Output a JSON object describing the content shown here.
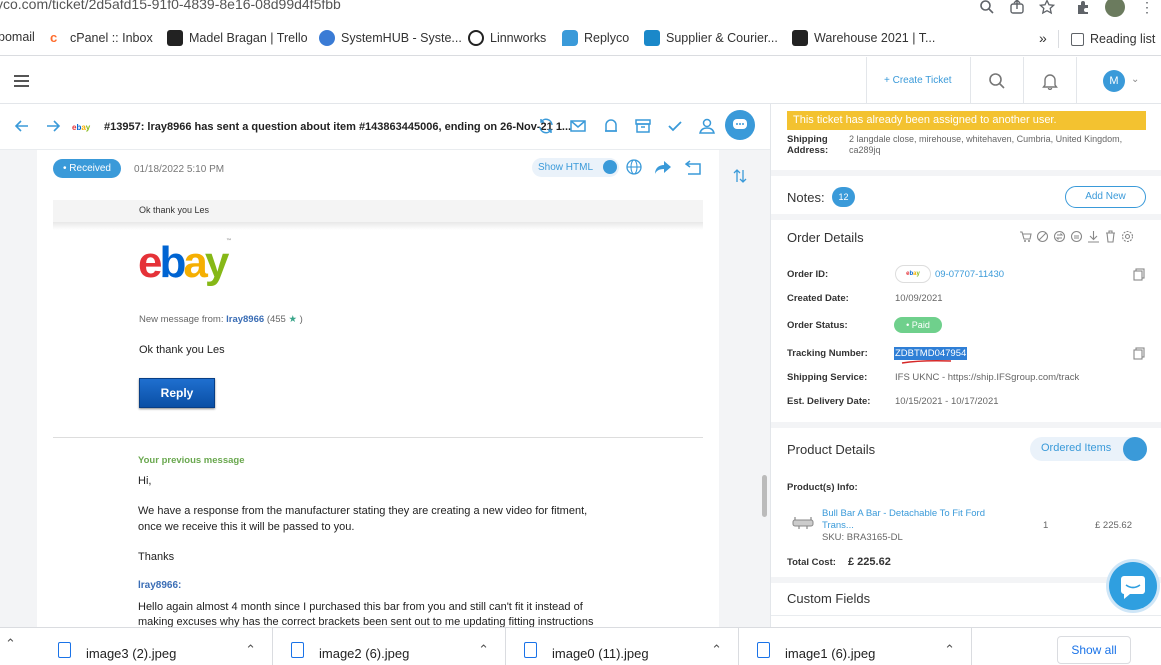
{
  "browser": {
    "url_prefix": "yco.com/ticket/",
    "url_rest": "2d5afd15-91f0-4839-8e16-08d99d4f5fbb",
    "bookmarks": [
      {
        "label": "pomail",
        "icon": "mail-icon",
        "color": "#d44638"
      },
      {
        "label": "cPanel :: Inbox",
        "icon": "cpanel-icon",
        "color": "#ff6c2c"
      },
      {
        "label": "Madel Bragan | Trello",
        "icon": "trello-icon",
        "color": "#222222"
      },
      {
        "label": "SystemHUB - Syste...",
        "icon": "systemhub-icon",
        "color": "#3a7bd5"
      },
      {
        "label": "Linnworks",
        "icon": "linnworks-icon",
        "color": "#222222"
      },
      {
        "label": "Replyco",
        "icon": "replyco-icon",
        "color": "#3a9ad9"
      },
      {
        "label": "Supplier & Courier...",
        "icon": "supplier-icon",
        "color": "#1a88c9"
      },
      {
        "label": "Warehouse 2021 | T...",
        "icon": "warehouse-icon",
        "color": "#222222"
      }
    ],
    "more_label": "»",
    "reading_list": "Reading list"
  },
  "header": {
    "create_ticket": "+ Create Ticket",
    "avatar_letter": "M"
  },
  "ticket": {
    "title": "#13957: lray8966 has sent a question about item #143863445006, ending on 26-Nov-21 1...",
    "source_badge": "ebay"
  },
  "message": {
    "status": "• Received",
    "date": "01/18/2022 5:10 PM",
    "show_html": "Show HTML",
    "preview": "Ok thank you Les",
    "new_message_label": "New message from:",
    "sender": "lray8966",
    "sender_score": "(455",
    "sender_score_end": ")",
    "body": "Ok thank you Les",
    "reply_button": "Reply",
    "previous_heading": "Your previous message",
    "prev_lines": [
      "Hi,",
      "We have a response from the manufacturer stating they are creating a new video for fitment,",
      "once we receive this it will be passed to you.",
      "Thanks"
    ],
    "quoted_sender": "lray8966:",
    "quoted_lines": [
      "Hello again almost 4 month since I purchased this bar from you and still can't fit it instead of",
      "making excuses why has the correct brackets been sent out to me updating fitting instructions"
    ]
  },
  "panel": {
    "warning": "This ticket has already been assigned to another user.",
    "shipping_label": "Shipping Address:",
    "shipping_label_1": "Shipping",
    "shipping_label_2": "Address:",
    "shipping_line1": "2 langdale close, mirehouse, whitehaven, Cumbria, United Kingdom,",
    "shipping_line2": "ca289jq",
    "notes_label": "Notes:",
    "notes_count": "12",
    "add_new": "Add New",
    "order_details": "Order Details",
    "order_id_label": "Order ID:",
    "order_id": "09-07707-11430",
    "created_label": "Created Date:",
    "created": "10/09/2021",
    "status_label": "Order Status:",
    "status": "• Paid",
    "tracking_label": "Tracking Number:",
    "tracking": "ZDBTMD047954",
    "shipping_service_label": "Shipping Service:",
    "shipping_service": "IFS UKNC - https://ship.IFSgroup.com/track",
    "delivery_label": "Est. Delivery Date:",
    "delivery": "10/15/2021 - 10/17/2021",
    "product_details": "Product Details",
    "ordered_items": "Ordered Items",
    "products_info": "Product(s) Info:",
    "product_name_1": "Bull Bar A Bar - Detachable To Fit Ford",
    "product_name_2": "Trans...",
    "product_sku": "SKU: BRA3165-DL",
    "product_qty": "1",
    "product_price": "£ 225.62",
    "total_label": "Total Cost:",
    "total": "£ 225.62",
    "custom_fields": "Custom Fields"
  },
  "downloads": {
    "items": [
      "image3 (2).jpeg",
      "image2 (6).jpeg",
      "image0 (11).jpeg",
      "image1 (6).jpeg"
    ],
    "show_all": "Show all"
  },
  "colors": {
    "accent": "#3a9ad9",
    "warning": "#f3c230",
    "paid": "#6fd08c"
  }
}
